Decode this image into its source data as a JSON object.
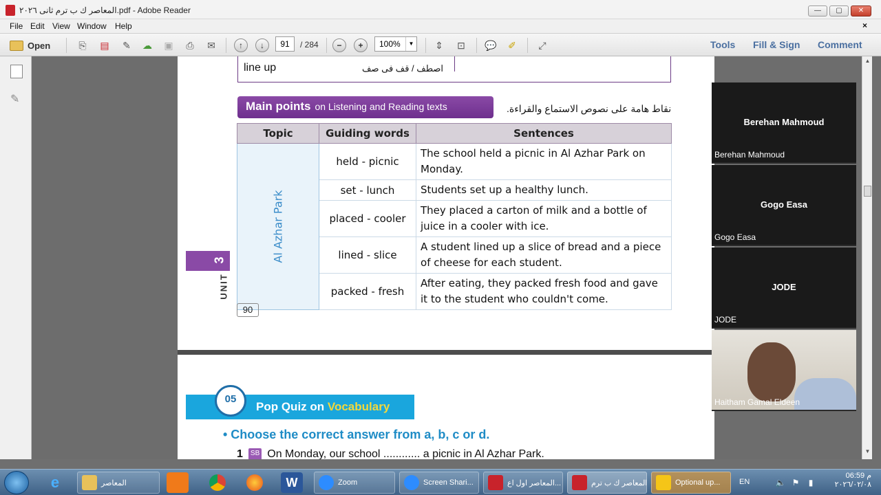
{
  "window": {
    "title": "المعاصر ك ب ترم ثانى ٢٠٢٦.pdf - Adobe Reader",
    "minimize": "—",
    "maximize": "▢",
    "close": "✕"
  },
  "menu": {
    "items": [
      "File",
      "Edit",
      "View",
      "Window",
      "Help"
    ],
    "doc_close": "×"
  },
  "toolbar": {
    "open_label": "Open",
    "page_current": "91",
    "page_total": "/ 284",
    "zoom": "100%",
    "tools": "Tools",
    "fill_sign": "Fill & Sign",
    "comment": "Comment"
  },
  "document": {
    "fragment": {
      "english": "line up",
      "arabic": "اصطف / قف فى صف"
    },
    "main_points": {
      "title_bold": "Main points",
      "title_rest": "on Listening and Reading texts",
      "arabic": "نقاط هامة على نصوص الاستماع والقراءة."
    },
    "table": {
      "headers": [
        "Topic",
        "Guiding words",
        "Sentences"
      ],
      "topic": "Al Azhar Park",
      "rows": [
        {
          "words": "held - picnic",
          "sentence": "The school held a picnic in Al Azhar Park on Monday."
        },
        {
          "words": "set - lunch",
          "sentence": "Students set up a healthy lunch."
        },
        {
          "words": "placed - cooler",
          "sentence": "They placed a carton of milk and a bottle of juice in a cooler with ice."
        },
        {
          "words": "lined - slice",
          "sentence": "A student lined up a slice of bread and a piece of cheese for each student."
        },
        {
          "words": "packed - fresh",
          "sentence": "After eating, they packed fresh food and gave it to the student who couldn't come."
        }
      ]
    },
    "unit_number": "3",
    "unit_word": "UNIT",
    "page_number": "90",
    "quiz": {
      "clock": "05",
      "title_a": "Pop Quiz on",
      "title_b": "Vocabulary",
      "instruction": "• Choose the correct answer from a, b, c or d.",
      "q_number": "1",
      "q_badge": "SB",
      "q_text": "On Monday, our school ............ a picnic in Al Azhar Park."
    }
  },
  "zoom_participants": [
    {
      "center": "Berehan Mahmoud",
      "corner": "Berehan Mahmoud"
    },
    {
      "center": "Gogo Easa",
      "corner": "Gogo Easa"
    },
    {
      "center": "JODE",
      "corner": "JODE"
    },
    {
      "center": "",
      "corner": "Haitham Gamal Eldeen"
    }
  ],
  "taskbar": {
    "apps": [
      {
        "label": "المعاصر"
      },
      {
        "label": "Zoom"
      },
      {
        "label": "Screen Shari..."
      },
      {
        "label": "المعاصر اول اع..."
      },
      {
        "label": "المعاصر ك ب ترم..."
      },
      {
        "label": "Optional up..."
      }
    ],
    "language": "EN",
    "time": "06:59 م",
    "date": "٢٠٢٦/٠٢/٠٨"
  }
}
